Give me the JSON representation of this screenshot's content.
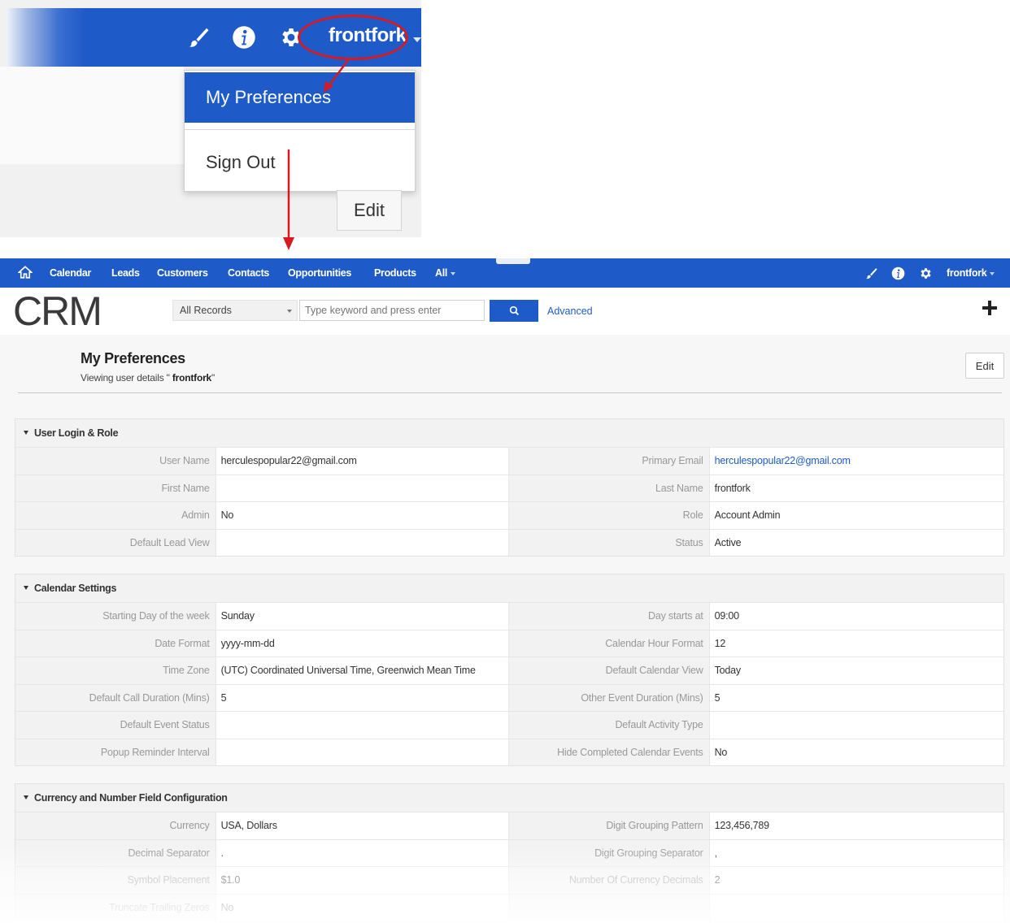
{
  "inset": {
    "username": "frontfork",
    "menu": {
      "preferences": "My Preferences",
      "sign_out": "Sign Out"
    },
    "edit_label": "Edit"
  },
  "nav": {
    "items": [
      "Calendar",
      "Leads",
      "Customers",
      "Contacts",
      "Opportunities",
      "Products",
      "All"
    ],
    "username": "frontfork"
  },
  "search": {
    "logo_text": "CRM",
    "records_select": "All Records",
    "placeholder": "Type keyword and press enter",
    "advanced": "Advanced"
  },
  "page": {
    "title": "My Preferences",
    "subtitle_prefix": "Viewing user details",
    "subtitle_user_open": " \" ",
    "subtitle_user": "frontfork",
    "subtitle_user_close": "\"",
    "edit_label": "Edit"
  },
  "sections": {
    "login": {
      "title": "User Login & Role",
      "rows": [
        {
          "l1": "User Name",
          "v1": "herculespopular22@gmail.com",
          "l2": "Primary Email",
          "v2": "herculespopular22@gmail.com"
        },
        {
          "l1": "First Name",
          "v1": "",
          "l2": "Last Name",
          "v2": "frontfork"
        },
        {
          "l1": "Admin",
          "v1": "No",
          "l2": "Role",
          "v2": "Account Admin"
        },
        {
          "l1": "Default Lead View",
          "v1": "",
          "l2": "Status",
          "v2": "Active"
        }
      ]
    },
    "calendar": {
      "title": "Calendar Settings",
      "rows": [
        {
          "l1": "Starting Day of the week",
          "v1": "Sunday",
          "l2": "Day starts at",
          "v2": "09:00"
        },
        {
          "l1": "Date Format",
          "v1": "yyyy-mm-dd",
          "l2": "Calendar Hour Format",
          "v2": "12"
        },
        {
          "l1": "Time Zone",
          "v1": "(UTC) Coordinated Universal Time, Greenwich Mean Time",
          "l2": "Default Calendar View",
          "v2": "Today"
        },
        {
          "l1": "Default Call Duration (Mins)",
          "v1": "5",
          "l2": "Other Event Duration (Mins)",
          "v2": "5"
        },
        {
          "l1": "Default Event Status",
          "v1": "",
          "l2": "Default Activity Type",
          "v2": ""
        },
        {
          "l1": "Popup Reminder Interval",
          "v1": "",
          "l2": "Hide Completed Calendar Events",
          "v2": "No"
        }
      ]
    },
    "currency": {
      "title": "Currency and Number Field Configuration",
      "rows": [
        {
          "l1": "Currency",
          "v1": "USA, Dollars",
          "l2": "Digit Grouping Pattern",
          "v2": "123,456,789"
        },
        {
          "l1": "Decimal Separator",
          "v1": ".",
          "l2": "Digit Grouping Separator",
          "v2": ","
        },
        {
          "l1": "Symbol Placement",
          "v1": "$1.0",
          "l2": "Number Of Currency Decimals",
          "v2": "2"
        },
        {
          "l1": "Truncate Trailing Zeros",
          "v1": "No",
          "l2": "",
          "v2": ""
        }
      ]
    }
  },
  "colors": {
    "brand_blue": "#1f5bc8",
    "annotation_red": "#d71921",
    "label_gray": "#999999"
  },
  "icons": [
    "paint-brush-icon",
    "info-icon",
    "gear-icon",
    "home-icon",
    "search-icon",
    "plus-icon",
    "chevron-down-icon"
  ]
}
